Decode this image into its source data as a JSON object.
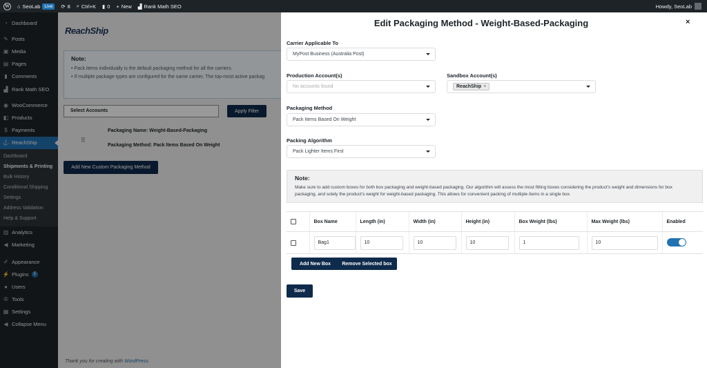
{
  "admin_bar": {
    "site_name": "SeoLab",
    "live_badge": "Live",
    "updates_count": "8",
    "shortcut": "Ctrl+K",
    "comments_count": "0",
    "new_label": "New",
    "rank_math": "Rank Math SEO",
    "howdy": "Howdy, SeoLab"
  },
  "sidebar": {
    "items_top": [
      {
        "label": "Dashboard",
        "icon": "dashboard-icon"
      },
      {
        "label": "Posts",
        "icon": "pin-icon"
      },
      {
        "label": "Media",
        "icon": "media-icon"
      },
      {
        "label": "Pages",
        "icon": "page-icon"
      },
      {
        "label": "Comments",
        "icon": "comment-icon"
      },
      {
        "label": "Rank Math SEO",
        "icon": "chart-icon"
      },
      {
        "label": "WooCommerce",
        "icon": "woo-icon"
      },
      {
        "label": "Products",
        "icon": "box-icon"
      },
      {
        "label": "Payments",
        "icon": "dollar-icon"
      },
      {
        "label": "ReachShip",
        "icon": "ship-icon"
      }
    ],
    "submenu": [
      "Dashboard",
      "Shipments & Printing",
      "Bulk History",
      "Conditional Shipping",
      "Settings",
      "Address Validation",
      "Help & Support"
    ],
    "items_bottom": [
      {
        "label": "Analytics",
        "icon": "analytics-icon"
      },
      {
        "label": "Marketing",
        "icon": "megaphone-icon"
      },
      {
        "label": "Appearance",
        "icon": "brush-icon"
      },
      {
        "label": "Plugins",
        "icon": "plug-icon"
      },
      {
        "label": "Users",
        "icon": "user-icon"
      },
      {
        "label": "Tools",
        "icon": "wrench-icon"
      },
      {
        "label": "Settings",
        "icon": "sliders-icon"
      },
      {
        "label": "Collapse Menu",
        "icon": "collapse-icon"
      }
    ],
    "plugins_badge": "5"
  },
  "background_page": {
    "logo": "ReachShip",
    "note_title": "Note:",
    "note_line1": "Pack items individually is the default packaging method for all the carriers.",
    "note_line2": "If multiple package types are configured for the same carrier, The top-most active packag",
    "select_accounts": "Select Accounts",
    "apply_filter": "Apply Filter",
    "packaging_name": "Packaging Name: Weight-Based-Packaging",
    "packaging_method": "Packaging Method: Pack Items Based On Weight",
    "add_custom": "Add New Custom Packaging Method",
    "footer_text": "Thank you for creating with ",
    "footer_link": "WordPress."
  },
  "drawer": {
    "title": "Edit Packaging Method - Weight-Based-Packaging",
    "close": "×",
    "carrier_label": "Carrier Applicable To",
    "carrier_value": "MyPost Business (Australia Post)",
    "production_label": "Production Account(s)",
    "production_placeholder": "No accounts found",
    "sandbox_label": "Sandbox Account(s)",
    "sandbox_chip": "ReachShip",
    "sandbox_chip_remove": "×",
    "method_label": "Packaging Method",
    "method_value": "Pack Items Based On Weight",
    "algorithm_label": "Packing Algorithm",
    "algorithm_value": "Pack Lighter Items First",
    "note_title": "Note:",
    "note_body": "Make sure to add custom boxes for both box packaging and weight-based packaging. Our algorithm will assess the most fitting boxes considering the product's weight and dimensions for box packaging, and solely the product's weight for weight-based packaging. This allows for convenient packing of multiple items in a single box.",
    "table": {
      "headers": [
        "Box Name",
        "Length (in)",
        "Width (in)",
        "Height (in)",
        "Box Weight (lbs)",
        "Max Weight (lbs)",
        "Enabled"
      ],
      "row": {
        "box_name": "Bag1",
        "length": "10",
        "width": "10",
        "height": "10",
        "box_weight": "1",
        "max_weight": "10",
        "enabled": true
      }
    },
    "add_box": "Add New Box",
    "remove_box": "Remove Selected box",
    "save": "Save"
  }
}
